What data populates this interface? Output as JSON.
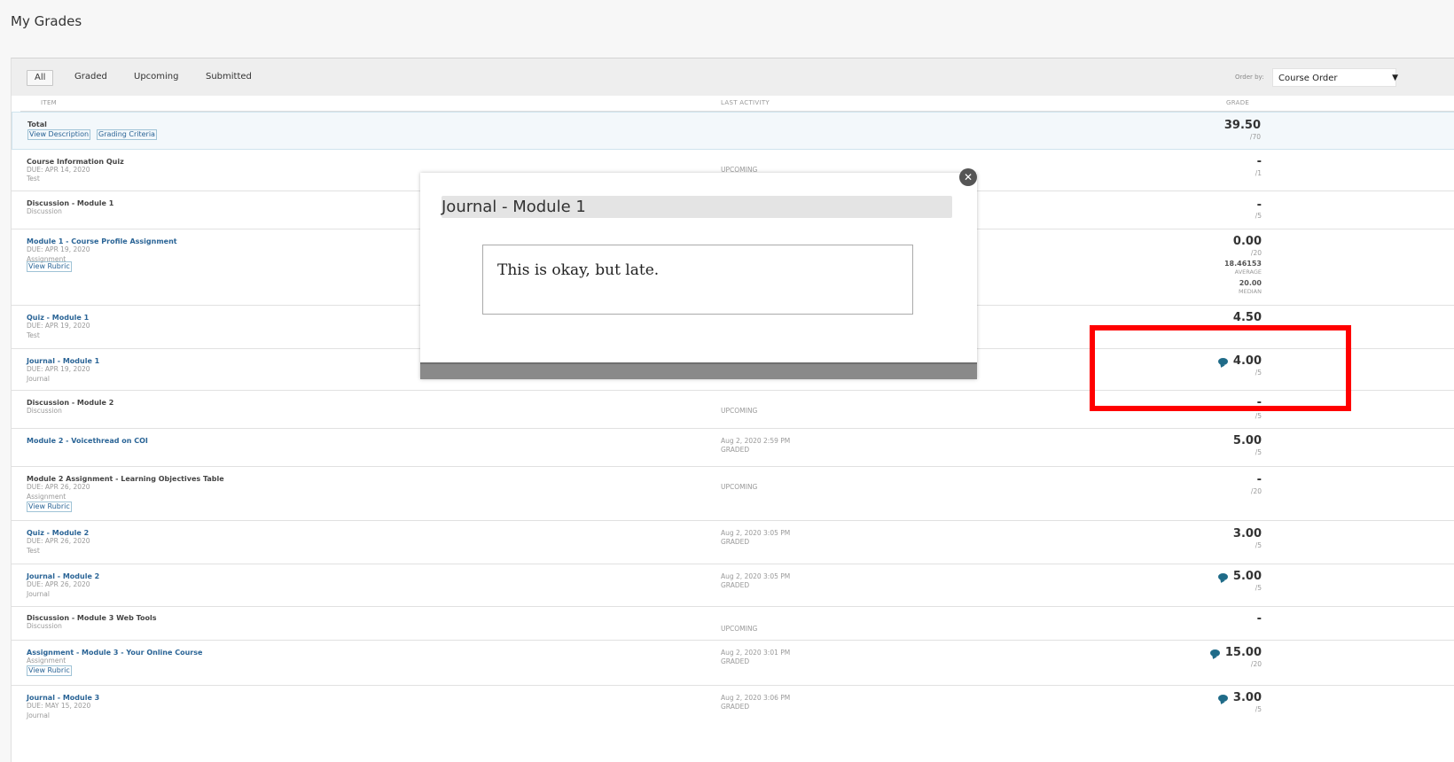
{
  "page": {
    "title": "My Grades"
  },
  "filters": {
    "all": "All",
    "graded": "Graded",
    "upcoming": "Upcoming",
    "submitted": "Submitted"
  },
  "order": {
    "label": "Order by:",
    "value": "Course Order"
  },
  "columns": {
    "item": "ITEM",
    "activity": "LAST ACTIVITY",
    "grade": "GRADE"
  },
  "total": {
    "title": "Total",
    "link1": "View Description",
    "link2": "Grading Criteria",
    "grade": "39.50",
    "out_of": "/70"
  },
  "rows": [
    {
      "title": "Course Information Quiz",
      "due": "DUE: APR 14, 2020",
      "type": "Test",
      "activity": "UPCOMING",
      "grade": "-",
      "out_of": "/1"
    },
    {
      "title": "Discussion - Module 1",
      "type": "Discussion",
      "grade": "-",
      "out_of": "/5"
    },
    {
      "title": "Module 1 - Course Profile Assignment",
      "due": "DUE: APR 19, 2020",
      "type": "Assignment",
      "link": "View Rubric",
      "grade": "0.00",
      "out_of": "/20",
      "average": "18.46153",
      "average_label": "AVERAGE",
      "median": "20.00",
      "median_label": "MEDIAN"
    },
    {
      "title": "Quiz - Module 1",
      "due": "DUE: APR 19, 2020",
      "type": "Test",
      "grade": "4.50"
    },
    {
      "title": "Journal - Module 1",
      "due": "DUE: APR 19, 2020",
      "type": "Journal",
      "grade": "4.00",
      "out_of": "/5"
    },
    {
      "title": "Discussion - Module 2",
      "type": "Discussion",
      "activity": "UPCOMING",
      "grade": "-",
      "out_of": "/5"
    },
    {
      "title": "Module 2 - Voicethread on COI",
      "activity_date": "Aug 2, 2020 2:59 PM",
      "activity": "GRADED",
      "grade": "5.00",
      "out_of": "/5"
    },
    {
      "title": "Module 2 Assignment - Learning Objectives Table",
      "due": "DUE: APR 26, 2020",
      "type": "Assignment",
      "link": "View Rubric",
      "activity": "UPCOMING",
      "grade": "-",
      "out_of": "/20"
    },
    {
      "title": "Quiz - Module 2",
      "due": "DUE: APR 26, 2020",
      "type": "Test",
      "activity_date": "Aug 2, 2020 3:05 PM",
      "activity": "GRADED",
      "grade": "3.00",
      "out_of": "/5"
    },
    {
      "title": "Journal - Module 2",
      "due": "DUE: APR 26, 2020",
      "type": "Journal",
      "activity_date": "Aug 2, 2020 3:05 PM",
      "activity": "GRADED",
      "grade": "5.00",
      "out_of": "/5"
    },
    {
      "title": "Discussion - Module 3 Web Tools",
      "type": "Discussion",
      "activity": "UPCOMING",
      "grade": "-"
    },
    {
      "title": "Assignment - Module 3 - Your Online Course",
      "type": "Assignment",
      "link": "View Rubric",
      "activity_date": "Aug 2, 2020 3:01 PM",
      "activity": "GRADED",
      "grade": "15.00",
      "out_of": "/20"
    },
    {
      "title": "Journal - Module 3",
      "due": "DUE: MAY 15, 2020",
      "type": "Journal",
      "activity_date": "Aug 2, 2020 3:06 PM",
      "activity": "GRADED",
      "grade": "3.00",
      "out_of": "/5"
    }
  ],
  "modal": {
    "title": "Journal - Module 1",
    "comment": "This is okay, but late."
  },
  "icons": {
    "comment": "comment-bubble-icon",
    "close": "close-icon",
    "caret": "caret-down-icon"
  },
  "colors": {
    "link": "#2a6496",
    "highlight": "#ff0000",
    "comment_icon": "#1f6b88"
  }
}
